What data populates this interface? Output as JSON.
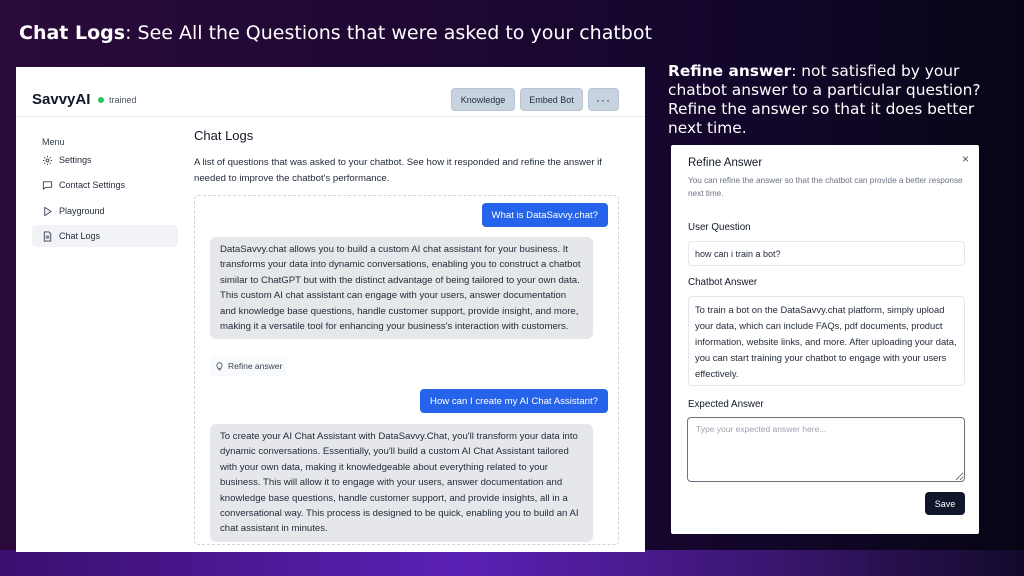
{
  "slide": {
    "title_bold": "Chat Logs",
    "title_rest": ": See All the Questions that were asked to your chatbot",
    "right_bold": "Refine answer",
    "right_rest": ": not satisfied by your chatbot answer to a particular question? Refine the answer so that it does better next time."
  },
  "app": {
    "brand": "SavvyAI",
    "status": "trained",
    "status_color": "#22c55e",
    "header_buttons": {
      "knowledge": "Knowledge",
      "embed": "Embed Bot",
      "more": "···"
    },
    "menu": {
      "title": "Menu",
      "items": [
        {
          "label": "Settings",
          "icon": "gear-icon"
        },
        {
          "label": "Contact Settings",
          "icon": "chat-bubble-icon"
        },
        {
          "label": "Playground",
          "icon": "play-icon"
        },
        {
          "label": "Chat Logs",
          "icon": "document-icon",
          "active": true
        }
      ]
    },
    "page_title": "Chat Logs",
    "page_desc": "A list of questions that was asked to your chatbot. See how it responded and refine the answer if needed to improve the chatbot's performance.",
    "chat": [
      {
        "question": "What is DataSavvy.chat?",
        "answer": "DataSavvy.chat allows you to build a custom AI chat assistant for your business. It transforms your data into dynamic conversations, enabling you to construct a chatbot similar to ChatGPT but with the distinct advantage of being tailored to your own data. This custom AI chat assistant can engage with your users, answer documentation and knowledge base questions, handle customer support, provide insight, and more, making it a versatile tool for enhancing your business's interaction with customers."
      },
      {
        "question": "How can I create my AI Chat Assistant?",
        "answer": "To create your AI Chat Assistant with DataSavvy.Chat, you'll transform your data into dynamic conversations. Essentially, you'll build a custom AI Chat Assistant tailored with your own data, making it knowledgeable about everything related to your business. This will allow it to engage with your users, answer documentation and knowledge base questions, handle customer support, and provide insights, all in a conversational way. This process is designed to be quick, enabling you to build an AI chat assistant in minutes."
      }
    ],
    "refine_label": "Refine answer",
    "accent_color": "#2563eb"
  },
  "modal": {
    "title": "Refine Answer",
    "close": "×",
    "subtitle": "You can refine the answer so that the chatbot can provide a better response next time.",
    "user_question_label": "User Question",
    "user_question_value": "how can i train a bot?",
    "chatbot_answer_label": "Chatbot Answer",
    "chatbot_answer_value": "To train a bot on the DataSavvy.chat platform, simply upload your data, which can include FAQs, pdf documents, product information, website links, and more. After uploading your data, you can start training your chatbot to engage with your users effectively.",
    "expected_answer_label": "Expected Answer",
    "expected_answer_placeholder": "Type your expected answer here...",
    "save_label": "Save"
  }
}
